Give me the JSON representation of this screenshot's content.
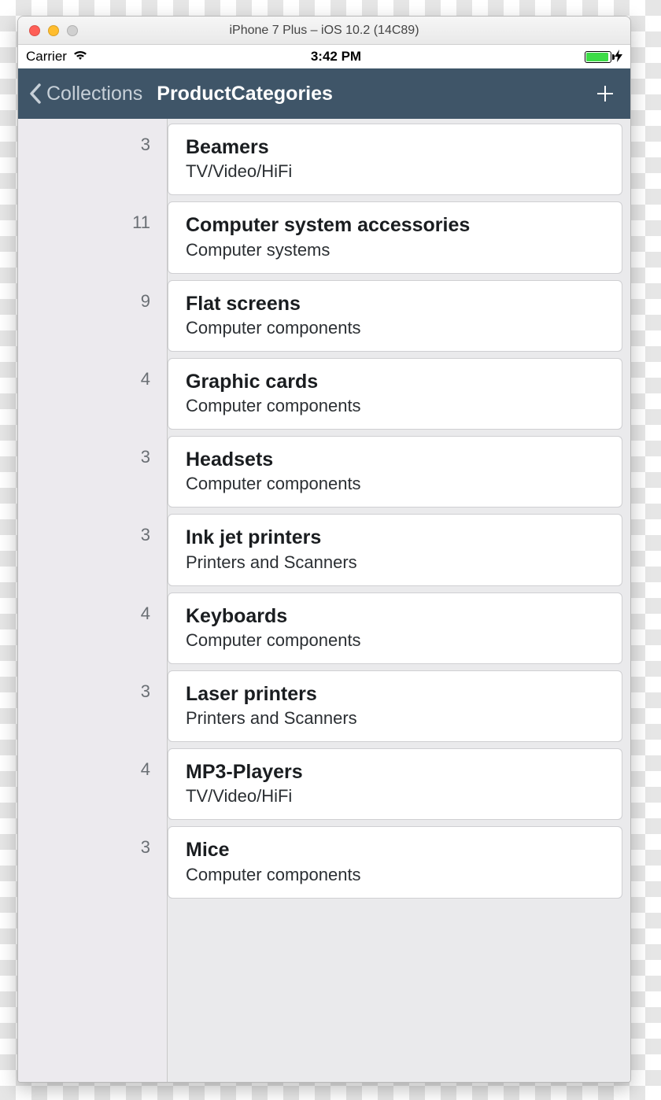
{
  "mac": {
    "title": "iPhone 7 Plus – iOS 10.2 (14C89)"
  },
  "statusbar": {
    "carrier": "Carrier",
    "time": "3:42 PM"
  },
  "nav": {
    "back_label": "Collections",
    "title": "ProductCategories"
  },
  "items": [
    {
      "count": "3",
      "title": "Beamers",
      "subtitle": "TV/Video/HiFi"
    },
    {
      "count": "11",
      "title": "Computer system accessories",
      "subtitle": "Computer systems"
    },
    {
      "count": "9",
      "title": "Flat screens",
      "subtitle": "Computer components"
    },
    {
      "count": "4",
      "title": "Graphic cards",
      "subtitle": "Computer components"
    },
    {
      "count": "3",
      "title": "Headsets",
      "subtitle": "Computer components"
    },
    {
      "count": "3",
      "title": "Ink jet printers",
      "subtitle": "Printers and Scanners"
    },
    {
      "count": "4",
      "title": "Keyboards",
      "subtitle": "Computer components"
    },
    {
      "count": "3",
      "title": "Laser printers",
      "subtitle": "Printers and Scanners"
    },
    {
      "count": "4",
      "title": "MP3-Players",
      "subtitle": "TV/Video/HiFi"
    },
    {
      "count": "3",
      "title": "Mice",
      "subtitle": "Computer components"
    }
  ]
}
